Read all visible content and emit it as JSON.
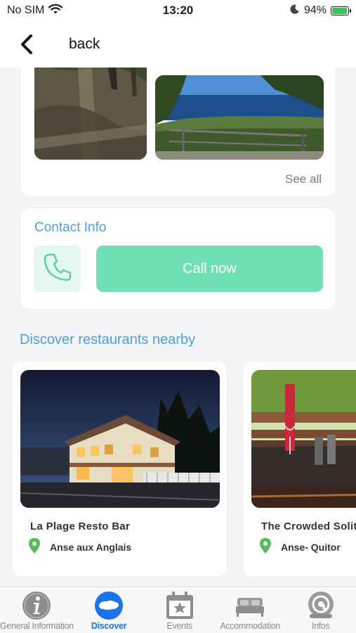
{
  "status": {
    "carrier": "No SIM",
    "time": "13:20",
    "battery": "94%",
    "battery_level": 0.94
  },
  "nav": {
    "back_label": "back"
  },
  "gallery": {
    "see_all": "See all"
  },
  "contact": {
    "title": "Contact Info",
    "call_label": "Call now"
  },
  "restaurants": {
    "section_title": "Discover restaurants nearby",
    "items": [
      {
        "name": "La Plage Resto Bar",
        "location": "Anse aux Anglais"
      },
      {
        "name": "The Crowded Solit",
        "location": "Anse- Quitor"
      }
    ]
  },
  "tabs": [
    {
      "label": "General Information",
      "icon": "info-icon"
    },
    {
      "label": "Discover",
      "icon": "island-icon"
    },
    {
      "label": "Events",
      "icon": "calendar-star-icon"
    },
    {
      "label": "Accommodation",
      "icon": "bed-icon"
    },
    {
      "label": "Infos",
      "icon": "at-icon"
    }
  ],
  "colors": {
    "accent_blue": "#4a9fd8",
    "call_green": "#6fe0b4",
    "tab_active": "#1a73e8",
    "pin_green": "#5cb85c"
  }
}
